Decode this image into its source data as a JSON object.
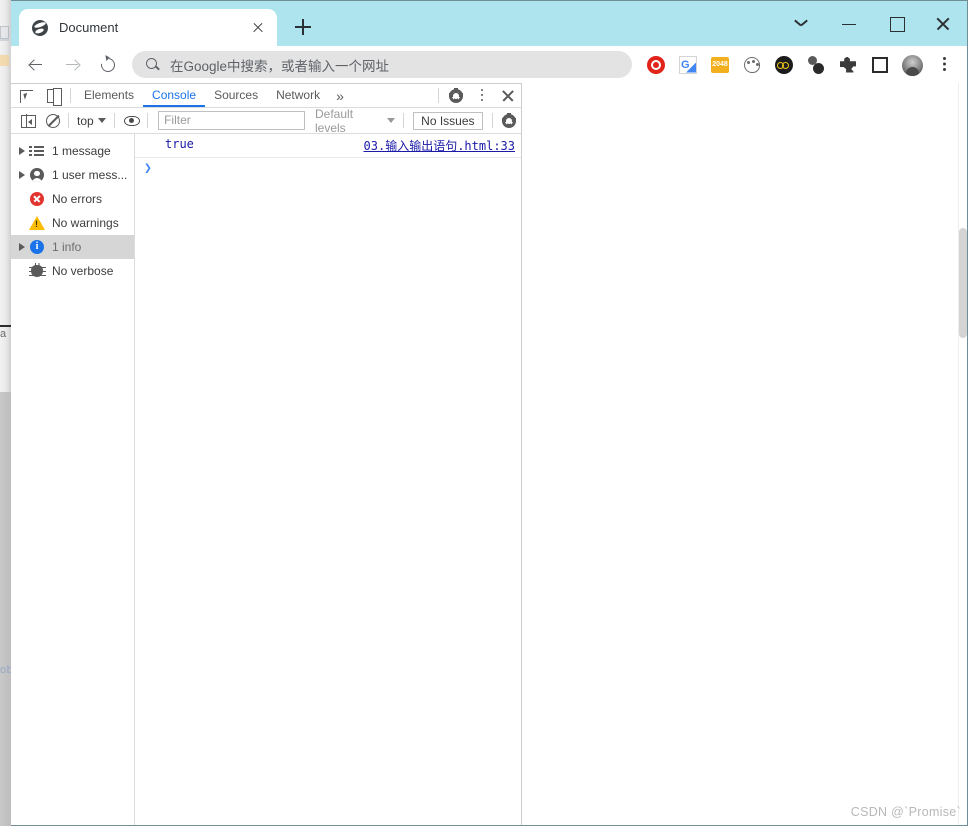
{
  "window": {
    "controls": [
      {
        "name": "tab-search",
        "glyph": "chevron-down"
      },
      {
        "name": "minimize",
        "glyph": "minus"
      },
      {
        "name": "maximize",
        "glyph": "square"
      },
      {
        "name": "close",
        "glyph": "x"
      }
    ],
    "titlebar_color": "#aee4ee"
  },
  "tabs": [
    {
      "title": "Document",
      "favicon": "globe-icon",
      "active": true,
      "close_label": "×"
    }
  ],
  "newtab": {
    "label": "+",
    "tooltip": "New tab"
  },
  "toolbar": {
    "back": "←",
    "forward": "→",
    "reload": "↻",
    "omnibox": {
      "placeholder": "在Google中搜索，或者输入一个网址",
      "value": "",
      "search_icon": "search-icon"
    },
    "extensions": [
      {
        "name": "adblock-icon",
        "label": "AdBlock",
        "color": "#e2231a"
      },
      {
        "name": "google-translate-icon",
        "label": "Google Translate",
        "color": "#4285f4"
      },
      {
        "name": "game-2048-icon",
        "label": "2048",
        "text": "2048",
        "color": "#f2b01e"
      },
      {
        "name": "palette-icon",
        "label": "Palette",
        "color": "#6b6b6b"
      },
      {
        "name": "infinity-icon",
        "label": "Infinity",
        "color": "#1c1c1c"
      },
      {
        "name": "molecule-icon",
        "label": "Molecule",
        "color": "#2b2b2b"
      },
      {
        "name": "puzzle-icon",
        "label": "Extensions",
        "color": "#3c3c3c"
      },
      {
        "name": "square-icon",
        "label": "Side panel",
        "color": "#2b2b2b"
      }
    ],
    "avatar": {
      "name": "avatar",
      "label": "Profile"
    },
    "menu": {
      "name": "kebab-menu-icon",
      "label": "Customize and control Google Chrome"
    }
  },
  "devtools": {
    "left_icons": [
      {
        "name": "inspect-element-icon",
        "label": "Inspect element"
      },
      {
        "name": "device-toolbar-icon",
        "label": "Toggle device toolbar"
      }
    ],
    "tabs": [
      {
        "label": "Elements",
        "active": false
      },
      {
        "label": "Console",
        "active": true
      },
      {
        "label": "Sources",
        "active": false
      },
      {
        "label": "Network",
        "active": false
      }
    ],
    "more_tabs": "»",
    "right_icons": [
      {
        "name": "settings-gear-icon",
        "label": "Settings"
      },
      {
        "name": "devtools-kebab-icon",
        "label": "Customize and control DevTools"
      },
      {
        "name": "close-devtools-icon",
        "label": "Close DevTools"
      }
    ],
    "filterbar": {
      "sidebar_toggle": {
        "name": "console-sidebar-toggle-icon",
        "label": "Hide console sidebar"
      },
      "clear": {
        "name": "clear-console-icon",
        "label": "Clear console"
      },
      "context": {
        "value": "top",
        "label": "JavaScript context"
      },
      "live_expression": {
        "name": "eye-icon",
        "label": "Create live expression"
      },
      "filter": {
        "placeholder": "Filter",
        "value": ""
      },
      "levels": {
        "value": "Default levels"
      },
      "issues": {
        "label": "No Issues"
      },
      "settings": {
        "name": "console-settings-gear-icon",
        "label": "Console settings"
      }
    },
    "sidebar": [
      {
        "label": "1 message",
        "icon": "list-icon",
        "expandable": true,
        "selected": false
      },
      {
        "label": "1 user mess...",
        "icon": "user-icon",
        "expandable": true,
        "selected": false
      },
      {
        "label": "No errors",
        "icon": "error-icon",
        "expandable": false,
        "selected": false
      },
      {
        "label": "No warnings",
        "icon": "warning-icon",
        "expandable": false,
        "selected": false
      },
      {
        "label": "1 info",
        "icon": "info-icon",
        "expandable": true,
        "selected": true
      },
      {
        "label": "No verbose",
        "icon": "bug-icon",
        "expandable": false,
        "selected": false
      }
    ],
    "console_messages": [
      {
        "value": "true",
        "source": "03.输入输出语句.html:33"
      }
    ],
    "prompt": {
      "caret": "❯",
      "value": ""
    }
  },
  "viewport": {
    "content": "",
    "watermark": "CSDN @`Promise`"
  },
  "background": {
    "hint_text": "ob",
    "a_text": "a"
  }
}
